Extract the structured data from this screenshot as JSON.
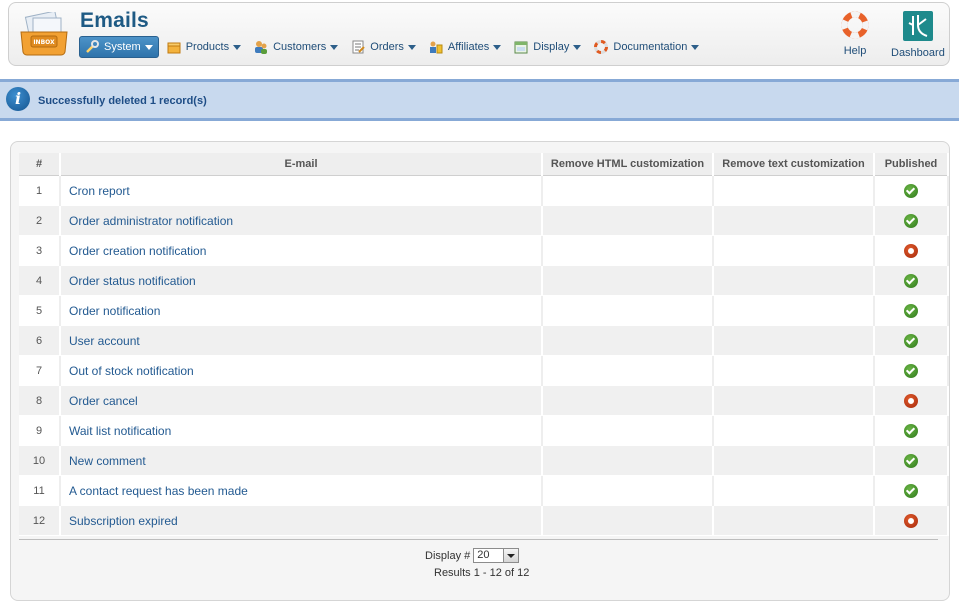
{
  "header": {
    "title": "Emails",
    "app_icon": "inbox-tray-icon",
    "app_icon_label": "INBOX",
    "menu": [
      {
        "label": "System",
        "icon": "wrench-icon",
        "active": true
      },
      {
        "label": "Products",
        "icon": "box-icon",
        "active": false
      },
      {
        "label": "Customers",
        "icon": "users-icon",
        "active": false
      },
      {
        "label": "Orders",
        "icon": "order-icon",
        "active": false
      },
      {
        "label": "Affiliates",
        "icon": "affiliate-icon",
        "active": false
      },
      {
        "label": "Display",
        "icon": "display-icon",
        "active": false
      },
      {
        "label": "Documentation",
        "icon": "lifebuoy-icon",
        "active": false
      }
    ],
    "help_label": "Help",
    "dashboard_label": "Dashboard"
  },
  "message": {
    "text": "Successfully deleted 1 record(s)",
    "icon": "info-icon"
  },
  "table": {
    "columns": [
      "#",
      "E-mail",
      "Remove HTML customization",
      "Remove text customization",
      "Published"
    ],
    "rows": [
      {
        "num": "1",
        "email": "Cron report",
        "published": true
      },
      {
        "num": "2",
        "email": "Order administrator notification",
        "published": true
      },
      {
        "num": "3",
        "email": "Order creation notification",
        "published": false
      },
      {
        "num": "4",
        "email": "Order status notification",
        "published": true
      },
      {
        "num": "5",
        "email": "Order notification",
        "published": true
      },
      {
        "num": "6",
        "email": "User account",
        "published": true
      },
      {
        "num": "7",
        "email": "Out of stock notification",
        "published": true
      },
      {
        "num": "8",
        "email": "Order cancel",
        "published": false
      },
      {
        "num": "9",
        "email": "Wait list notification",
        "published": true
      },
      {
        "num": "10",
        "email": "New comment",
        "published": true
      },
      {
        "num": "11",
        "email": "A contact request has been made",
        "published": true
      },
      {
        "num": "12",
        "email": "Subscription expired",
        "published": false
      }
    ]
  },
  "footer": {
    "display_label": "Display #",
    "display_value": "20",
    "results": "Results 1 - 12 of 12"
  }
}
